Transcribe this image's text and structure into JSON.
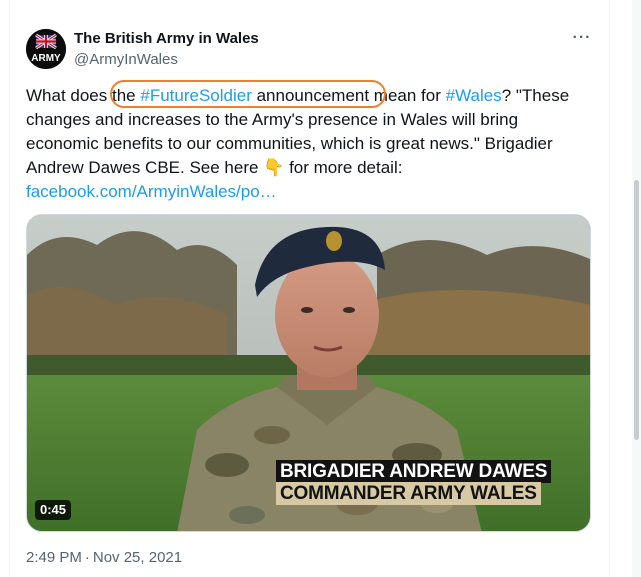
{
  "tweet": {
    "author": {
      "display_name": "The British Army in Wales",
      "handle": "@ArmyInWales",
      "avatar_text": "ARMY"
    },
    "more_icon": "more-horizontal-icon",
    "text": {
      "l1_a": "What does ",
      "l1_b": "the ",
      "l1_hashtag": "#FutureSoldier",
      "l1_c": " announcement",
      "l1_d": " mean for ",
      "l1_hashtag2": "#Wales",
      "l1_e": "? \"These",
      "l2": "changes and increases to the Army's presence in Wales will bring",
      "l3": "economic benefits to our communities, which is great news.\" Brigadier",
      "l4_a": "Andrew Dawes CBE. See here ",
      "l4_emoji": "👇",
      "l4_b": " for more detail:",
      "link": "facebook.com/ArmyinWales/po…"
    },
    "video": {
      "duration": "0:45",
      "caption_name": "BRIGADIER ANDREW DAWES",
      "caption_title": "COMMANDER ARMY WALES"
    },
    "time": "2:49 PM",
    "separator": "·",
    "date": "Nov 25, 2021"
  },
  "colors": {
    "link": "#1d9bf0",
    "annotation": "#f07f2d",
    "text": "#0f1419",
    "muted": "#536471"
  }
}
